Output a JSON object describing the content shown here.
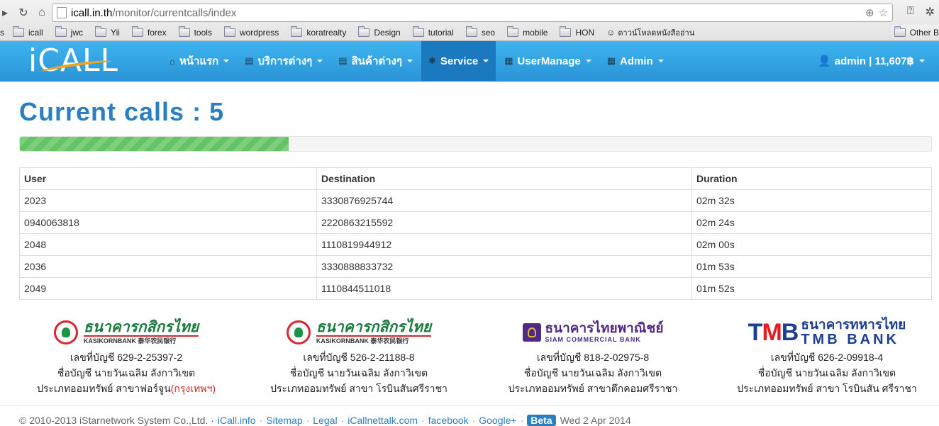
{
  "browser": {
    "url_host": "icall.in.th",
    "url_path": "/monitor/currentcalls/index",
    "bookmarks": [
      "icall",
      "jwc",
      "Yii",
      "forex",
      "tools",
      "wordpress",
      "koratrealty",
      "Design",
      "tutorial",
      "seo",
      "mobile",
      "HON",
      "ดาวน์โหลดหนังสืออ่าน"
    ],
    "bookmark_truncated_left": "s",
    "other_bookmarks": "Other B"
  },
  "navbar": {
    "logo": "iCALL",
    "items": [
      {
        "label": "หน้าแรก",
        "icon": "home-icon",
        "glyph": "⌂"
      },
      {
        "label": "บริการต่างๆ",
        "icon": "list-icon",
        "glyph": "▤"
      },
      {
        "label": "สินค้าต่างๆ",
        "icon": "list-icon",
        "glyph": "▤"
      },
      {
        "label": "Service",
        "icon": "gear-icon",
        "glyph": "✱"
      },
      {
        "label": "UserManage",
        "icon": "grid-icon",
        "glyph": "▦"
      },
      {
        "label": "Admin",
        "icon": "grid-icon",
        "glyph": "▦"
      }
    ],
    "active_item": "Service",
    "user_label": "admin | 11,607฿"
  },
  "page": {
    "title": "Current calls : 5",
    "progress_fraction": 0.295
  },
  "calls_table": {
    "columns": [
      "User",
      "Destination",
      "Duration"
    ],
    "rows": [
      [
        "2023",
        "3330876925744",
        "02m 32s"
      ],
      [
        "0940063818",
        "2220863215592",
        "02m 24s"
      ],
      [
        "2048",
        "1110819944912",
        "02m 00s"
      ],
      [
        "2036",
        "3330888833732",
        "01m 53s"
      ],
      [
        "2049",
        "1110844511018",
        "01m 52s"
      ]
    ]
  },
  "banks": [
    {
      "name_th": "ธนาคารกสิกรไทย",
      "name_en": "KASIKORNBANK 泰华农民银行",
      "account": "เลขที่บัญชี 629-2-25397-2",
      "holder": "ชื่อบัญชี นายวันเฉลิม ลังกาวิเขต",
      "type_prefix": "ประเภทออมทรัพย์ สาขาฟอร์จูน",
      "type_highlight": "(กรุงเทพฯ)"
    },
    {
      "name_th": "ธนาคารกสิกรไทย",
      "name_en": "KASIKORNBANK 泰华农民银行",
      "account": "เลขที่บัญชี 526-2-21188-8",
      "holder": "ชื่อบัญชี นายวันเฉลิม ลังกาวิเขต",
      "type_prefix": "ประเภทออมทรัพย์ สาขา โรบินสันศรีราชา",
      "type_highlight": ""
    },
    {
      "name_th": "ธนาคารไทยพาณิชย์",
      "name_en": "SIAM COMMERCIAL BANK",
      "account": "เลขที่บัญชี 818-2-02975-8",
      "holder": "ชื่อบัญชี นายวันเฉลิม ลังกาวิเขต",
      "type_prefix": "ประเภทออมทรัพย์ สาขาตึกคอมศรีราชา",
      "type_highlight": ""
    },
    {
      "name_th": "ธนาคารทหารไทย",
      "name_en": "TMB BANK",
      "logo_text": "TMB",
      "account": "เลขที่บัญชี 626-2-09918-4",
      "holder": "ชื่อบัญชี นายวันเฉลิม ลังกาวิเขต",
      "type_prefix": "ประเภทออมทรัพย์ สาขา โรบินสัน ศรีราชา",
      "type_highlight": ""
    }
  ],
  "footer": {
    "copyright": "© 2010-2013 iStarnetwork System Co.,Ltd. ·",
    "links": [
      "iCall.info",
      "Sitemap",
      "Legal",
      "iCallnettalk.com",
      "facebook",
      "Google+"
    ],
    "beta": "Beta",
    "date": "Wed 2 Apr 2014"
  },
  "colors": {
    "navbar": "#2a94d6",
    "nav_active": "#1b7abf",
    "title": "#2b7fc0",
    "progress": "#62c462",
    "highlight_red": "#d2271a"
  }
}
